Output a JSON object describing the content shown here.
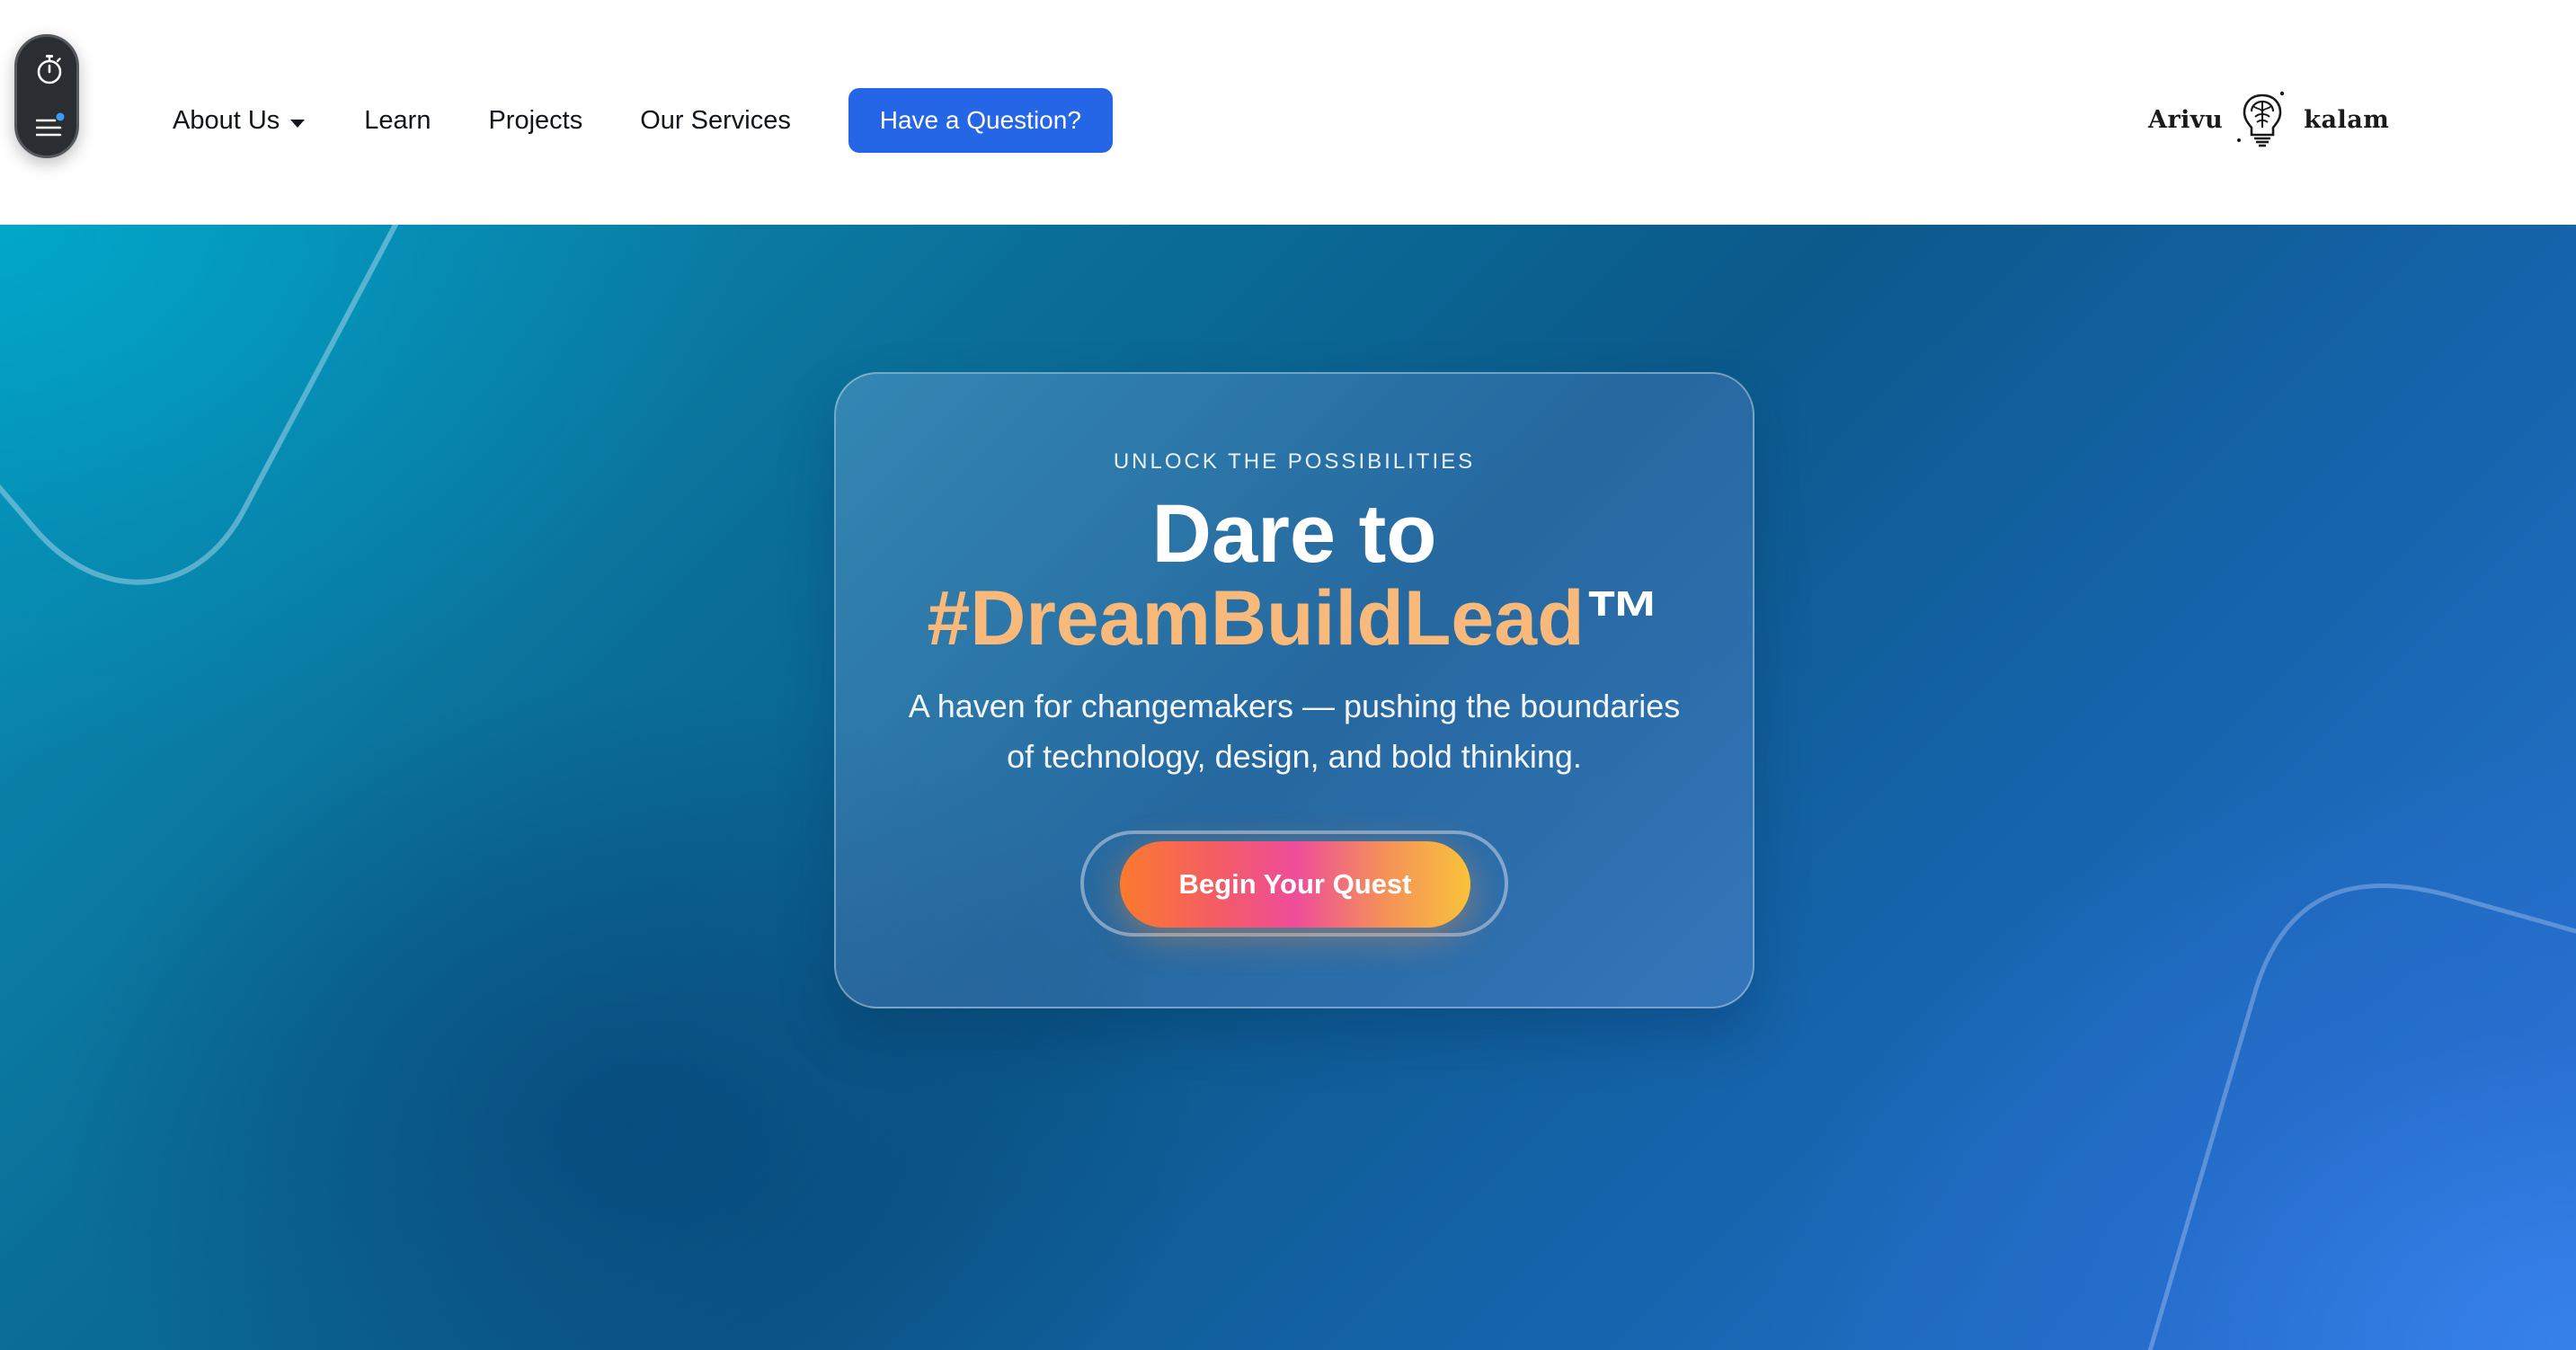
{
  "nav": {
    "about_label": "About Us",
    "learn_label": "Learn",
    "projects_label": "Projects",
    "services_label": "Our Services",
    "cta_label": "Have a Question?"
  },
  "side_widget": {
    "icons": [
      "timer-icon",
      "menu-icon"
    ],
    "notification_dot_color": "#3b9cf5"
  },
  "logo": {
    "word_left": "Arivu",
    "word_right": "kalam",
    "mark_icon": "lightbulb-brain-icon"
  },
  "hero": {
    "eyebrow": "UNLOCK THE POSSIBILITIES",
    "headline_line1": "Dare to",
    "headline_line2": "#DreamBuildLead",
    "headline_tm": "™",
    "subtitle_line1": "A haven for changemakers — pushing the boundaries",
    "subtitle_line2": "of technology, design, and bold thinking.",
    "button_label": "Begin Your Quest"
  },
  "colors": {
    "cta_blue": "#2466e6",
    "headline_accent": "#f8b97a",
    "button_gradient": [
      "#fb7a2e",
      "#ee4d9a",
      "#f9c23a"
    ]
  }
}
